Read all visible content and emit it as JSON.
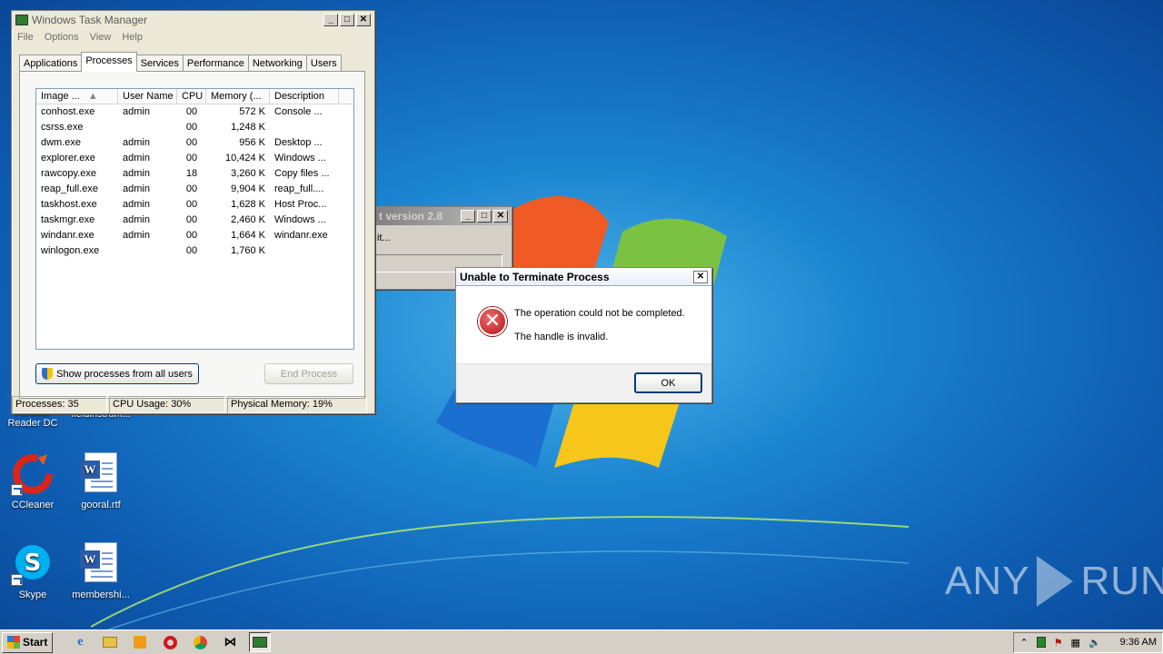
{
  "task_manager": {
    "title": "Windows Task Manager",
    "menu": [
      "File",
      "Options",
      "View",
      "Help"
    ],
    "tabs": [
      "Applications",
      "Processes",
      "Services",
      "Performance",
      "Networking",
      "Users"
    ],
    "active_tab": "Processes",
    "columns": [
      "Image ...",
      "User Name",
      "CPU",
      "Memory (...",
      "Description"
    ],
    "processes": [
      {
        "image": "conhost.exe",
        "user": "admin",
        "cpu": "00",
        "memory": "572 K",
        "desc": "Console ..."
      },
      {
        "image": "csrss.exe",
        "user": "",
        "cpu": "00",
        "memory": "1,248 K",
        "desc": ""
      },
      {
        "image": "dwm.exe",
        "user": "admin",
        "cpu": "00",
        "memory": "956 K",
        "desc": "Desktop ..."
      },
      {
        "image": "explorer.exe",
        "user": "admin",
        "cpu": "00",
        "memory": "10,424 K",
        "desc": "Windows ..."
      },
      {
        "image": "rawcopy.exe",
        "user": "admin",
        "cpu": "18",
        "memory": "3,260 K",
        "desc": "Copy files ..."
      },
      {
        "image": "reap_full.exe",
        "user": "admin",
        "cpu": "00",
        "memory": "9,904 K",
        "desc": "reap_full...."
      },
      {
        "image": "taskhost.exe",
        "user": "admin",
        "cpu": "00",
        "memory": "1,628 K",
        "desc": "Host Proc..."
      },
      {
        "image": "taskmgr.exe",
        "user": "admin",
        "cpu": "00",
        "memory": "2,460 K",
        "desc": "Windows ..."
      },
      {
        "image": "windanr.exe",
        "user": "admin",
        "cpu": "00",
        "memory": "1,664 K",
        "desc": "windanr.exe"
      },
      {
        "image": "winlogon.exe",
        "user": "",
        "cpu": "00",
        "memory": "1,760 K",
        "desc": ""
      }
    ],
    "show_all_label": "Show processes from all users",
    "end_process_label": "End Process",
    "status": {
      "processes": "Processes: 35",
      "cpu": "CPU Usage: 30%",
      "memory": "Physical Memory: 19%"
    }
  },
  "background_window": {
    "title_fragment": "t version 2.8",
    "body_fragment": "it..."
  },
  "error_dialog": {
    "title": "Unable to Terminate Process",
    "line1": "The operation could not be completed.",
    "line2": "The handle is invalid.",
    "ok_label": "OK"
  },
  "desktop_icons": [
    {
      "label": "Acrobat Reader DC",
      "icon": "acrobat-icon"
    },
    {
      "label": "fieldinstrum...",
      "icon": "document-icon"
    },
    {
      "label": "CCleaner",
      "icon": "ccleaner-icon"
    },
    {
      "label": "gooral.rtf",
      "icon": "word-document-icon"
    },
    {
      "label": "Skype",
      "icon": "skype-icon"
    },
    {
      "label": "membershi...",
      "icon": "word-document-icon"
    }
  ],
  "taskbar": {
    "start_label": "Start",
    "clock": "9:36 AM"
  },
  "watermark": {
    "left": "ANY",
    "right": "RUN"
  }
}
